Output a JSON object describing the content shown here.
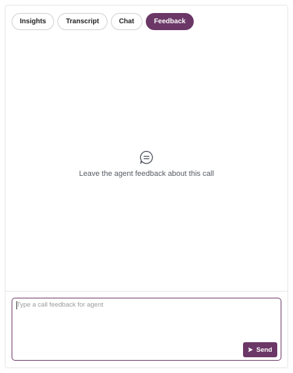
{
  "tabs": [
    {
      "label": "Insights",
      "active": false
    },
    {
      "label": "Transcript",
      "active": false
    },
    {
      "label": "Chat",
      "active": false
    },
    {
      "label": "Feedback",
      "active": true
    }
  ],
  "empty_state": {
    "icon": "chat-bubble-icon",
    "text": "Leave the agent feedback about this call"
  },
  "composer": {
    "placeholder": "Type a call feedback for agent",
    "value": "",
    "send_label": "Send",
    "send_icon": "send-icon"
  },
  "colors": {
    "accent": "#6b3767",
    "border": "#e6e6e6",
    "muted_text": "#555a63"
  }
}
